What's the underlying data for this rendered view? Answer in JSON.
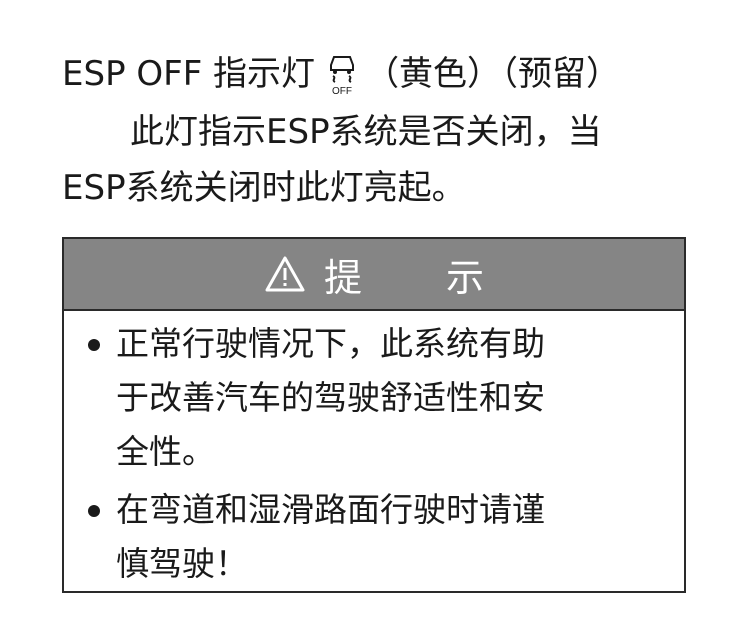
{
  "heading": {
    "label": "ESP OFF 指示灯",
    "icon_name": "esp-off-icon",
    "icon_text": "OFF",
    "suffix": "（黄色）（预留）"
  },
  "paragraph": {
    "line1": "此灯指示ESP系统是否关闭，当",
    "line2": "ESP系统关闭时此灯亮起。"
  },
  "notice": {
    "title": "提 示",
    "icon_name": "warning-triangle-icon",
    "header_color": "#858585",
    "items": [
      {
        "lines": [
          "正常行驶情况下，此系统有助",
          "于改善汽车的驾驶舒适性和安",
          "全性。"
        ]
      },
      {
        "lines": [
          "在弯道和湿滑路面行驶时请谨",
          "慎驾驶！"
        ]
      }
    ]
  }
}
